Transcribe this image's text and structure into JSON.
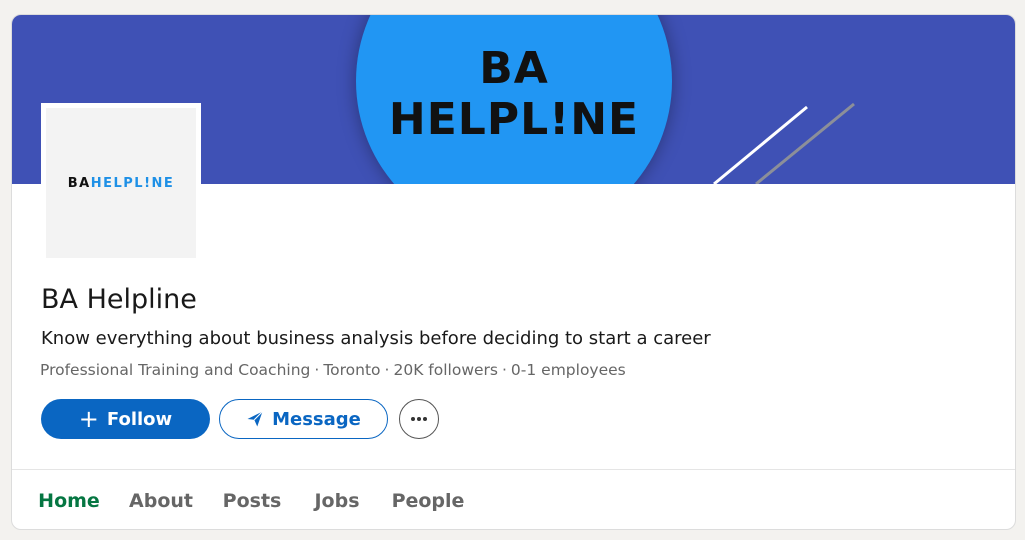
{
  "banner": {
    "logo_text": "BA HELPL!NE",
    "background_color": "#3f51b5",
    "circle_color": "#2196f3"
  },
  "logo": {
    "part1": "BA",
    "part2": "HELPL!NE"
  },
  "company": {
    "name": "BA Helpline",
    "tagline": "Know everything about business analysis before deciding to start a career",
    "industry": "Professional Training and Coaching",
    "location": "Toronto",
    "followers": "20K followers",
    "employees": "0-1 employees",
    "separator": "·"
  },
  "actions": {
    "follow_label": "Follow",
    "follow_icon": "plus-icon",
    "message_label": "Message",
    "message_icon": "paper-plane-icon",
    "more_icon": "ellipsis-icon",
    "accent_color": "#0a66c2"
  },
  "tabs": [
    {
      "label": "Home",
      "active": true
    },
    {
      "label": "About",
      "active": false
    },
    {
      "label": "Posts",
      "active": false
    },
    {
      "label": "Jobs",
      "active": false
    },
    {
      "label": "People",
      "active": false
    }
  ],
  "active_tab_color": "#057642"
}
